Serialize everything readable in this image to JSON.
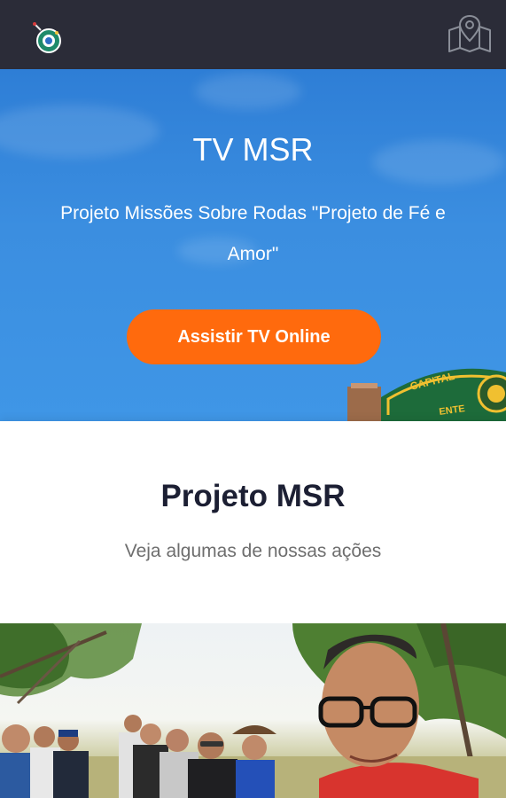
{
  "header": {
    "logo_icon": "emblem-logo-icon",
    "map_icon": "map-pin-icon"
  },
  "hero": {
    "title": "TV MSR",
    "subtitle": "Projeto Missões Sobre Rodas \"Projeto de Fé e Amor\"",
    "cta_label": "Assistir TV Online",
    "sign_text_top": "CAPITAL",
    "sign_text_bottom": "ENTE",
    "background_color": "#3b8ee0",
    "cta_color": "#ff6a0d"
  },
  "section": {
    "title": "Projeto MSR",
    "subtitle": "Veja algumas de nossas ações"
  },
  "photo": {
    "description_icon": "group-photo"
  }
}
